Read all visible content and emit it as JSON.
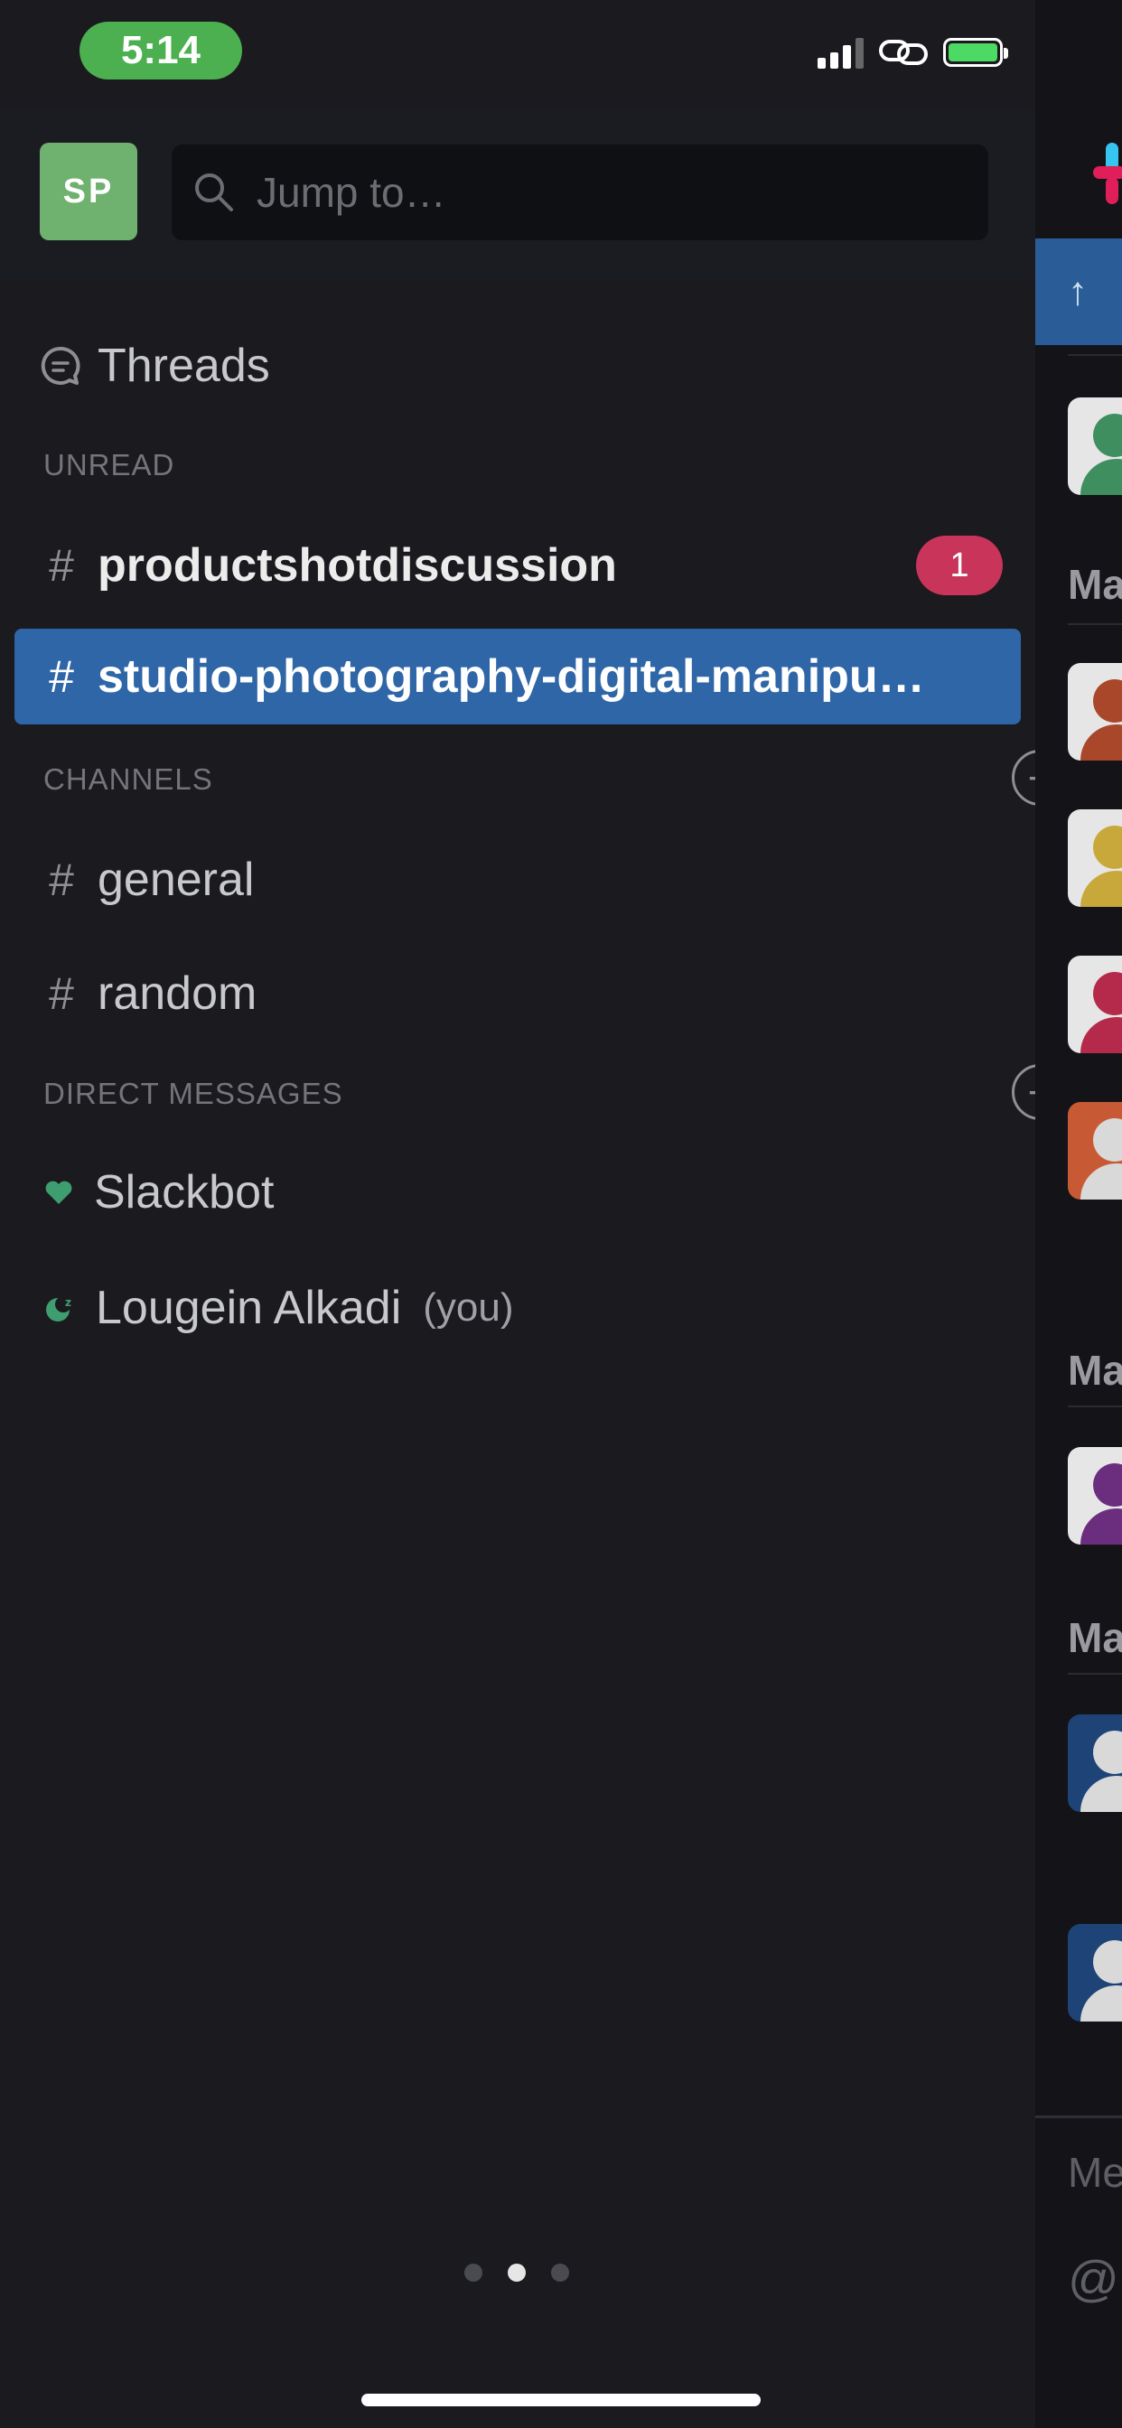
{
  "status_bar": {
    "time": "5:14"
  },
  "workspace": {
    "initials": "SP"
  },
  "search": {
    "placeholder": "Jump to…"
  },
  "sidebar": {
    "threads_label": "Threads",
    "unread_header": "UNREAD",
    "unread_channels": [
      {
        "name": "productshotdiscussion",
        "badge": "1"
      },
      {
        "name": "studio-photography-digital-manipu…"
      }
    ],
    "channels_header": "CHANNELS",
    "channels": [
      {
        "name": "general"
      },
      {
        "name": "random"
      }
    ],
    "dm_header": "DIRECT MESSAGES",
    "dms": [
      {
        "name": "Slackbot"
      },
      {
        "name": "Lougein Alkadi",
        "suffix": "(you)"
      }
    ]
  },
  "peek": {
    "banner_arrow": "↑",
    "day_labels": [
      "Ma",
      "Ma",
      "Ma"
    ],
    "input_partial": "Me",
    "mention_partial": "@"
  },
  "colors": {
    "accent_selected": "#2f66a7",
    "badge": "#c9345a",
    "workspace_avatar": "#6fb16f",
    "presence": "#3f9e6f"
  },
  "pager": {
    "pages": 3,
    "active_index": 1
  }
}
